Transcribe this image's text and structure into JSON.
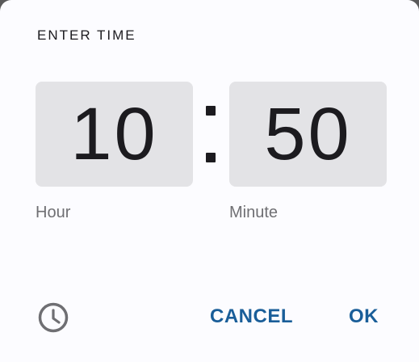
{
  "dialog": {
    "title": "ENTER TIME",
    "hour": {
      "value": "10",
      "caption": "Hour"
    },
    "minute": {
      "value": "50",
      "caption": "Minute"
    },
    "separator": ":",
    "mode_toggle_icon": "clock-icon",
    "actions": {
      "cancel_label": "CANCEL",
      "ok_label": "OK"
    }
  },
  "colors": {
    "accent": "#1a5e99",
    "field_background": "#e3e3e6",
    "surface": "#fcfcff"
  }
}
